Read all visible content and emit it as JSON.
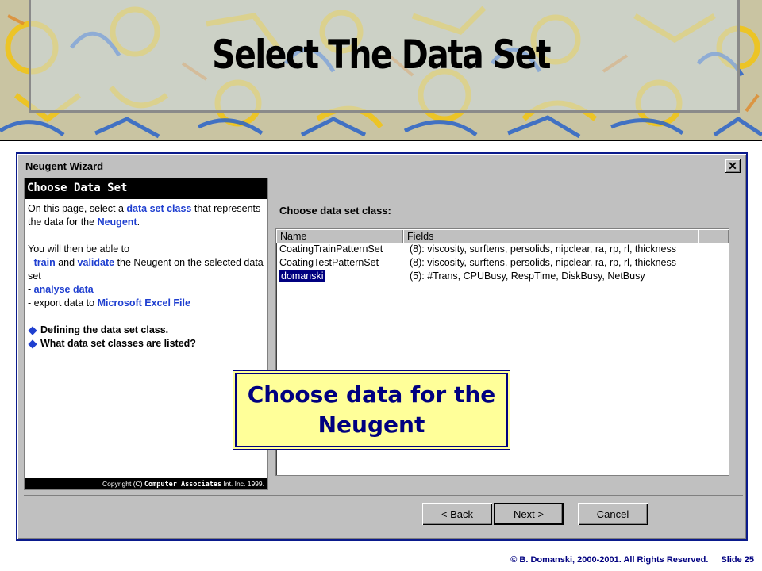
{
  "slide": {
    "title": "Select The Data Set",
    "copyright": "© B. Domanski, 2000-2001.  All Rights Reserved.",
    "slide_number": "Slide 25"
  },
  "window": {
    "title": "Neugent Wizard",
    "close_glyph": "✕"
  },
  "help": {
    "header": "Choose Data Set",
    "intro_prefix": "On this page, select a ",
    "intro_link": "data set class",
    "intro_mid": " that represents the data for the ",
    "intro_neugent": "Neugent",
    "intro_suffix": ".",
    "able_line": "You will then be able to",
    "bullet1_prefix": "- ",
    "bullet1_train": "train",
    "bullet1_and": " and ",
    "bullet1_validate": "validate",
    "bullet1_suffix": " the Neugent on the selected data set",
    "bullet2_prefix": "- ",
    "bullet2_link": "analyse data",
    "bullet3_prefix": "- export data to ",
    "bullet3_link": "Microsoft Excel File",
    "link1": "Defining the data set class.",
    "link2": "What data set classes are listed?",
    "footer_prefix": "Copyright (C) ",
    "footer_company": "Computer Associates",
    "footer_suffix": " Int. Inc. 1999."
  },
  "main": {
    "prompt": "Choose data set class:",
    "columns": [
      "Name",
      "Fields"
    ],
    "rows": [
      {
        "name": "CoatingTrainPatternSet",
        "fields": "(8): viscosity, surftens, persolids, nipclear, ra, rp, rl, thickness",
        "selected": false
      },
      {
        "name": "CoatingTestPatternSet",
        "fields": "(8): viscosity, surftens, persolids, nipclear, ra, rp, rl, thickness",
        "selected": false
      },
      {
        "name": "domanski",
        "fields": "(5): #Trans, CPUBusy, RespTime, DiskBusy, NetBusy",
        "selected": true
      }
    ]
  },
  "callout": {
    "line1": "Choose data for the",
    "line2": "Neugent"
  },
  "buttons": {
    "back": "< Back",
    "next": "Next >",
    "cancel": "Cancel"
  },
  "colors": {
    "window_border": "#0a1a8c",
    "help_link": "#1f3fd0",
    "selection": "#000080",
    "callout_bg": "#ffff99"
  }
}
